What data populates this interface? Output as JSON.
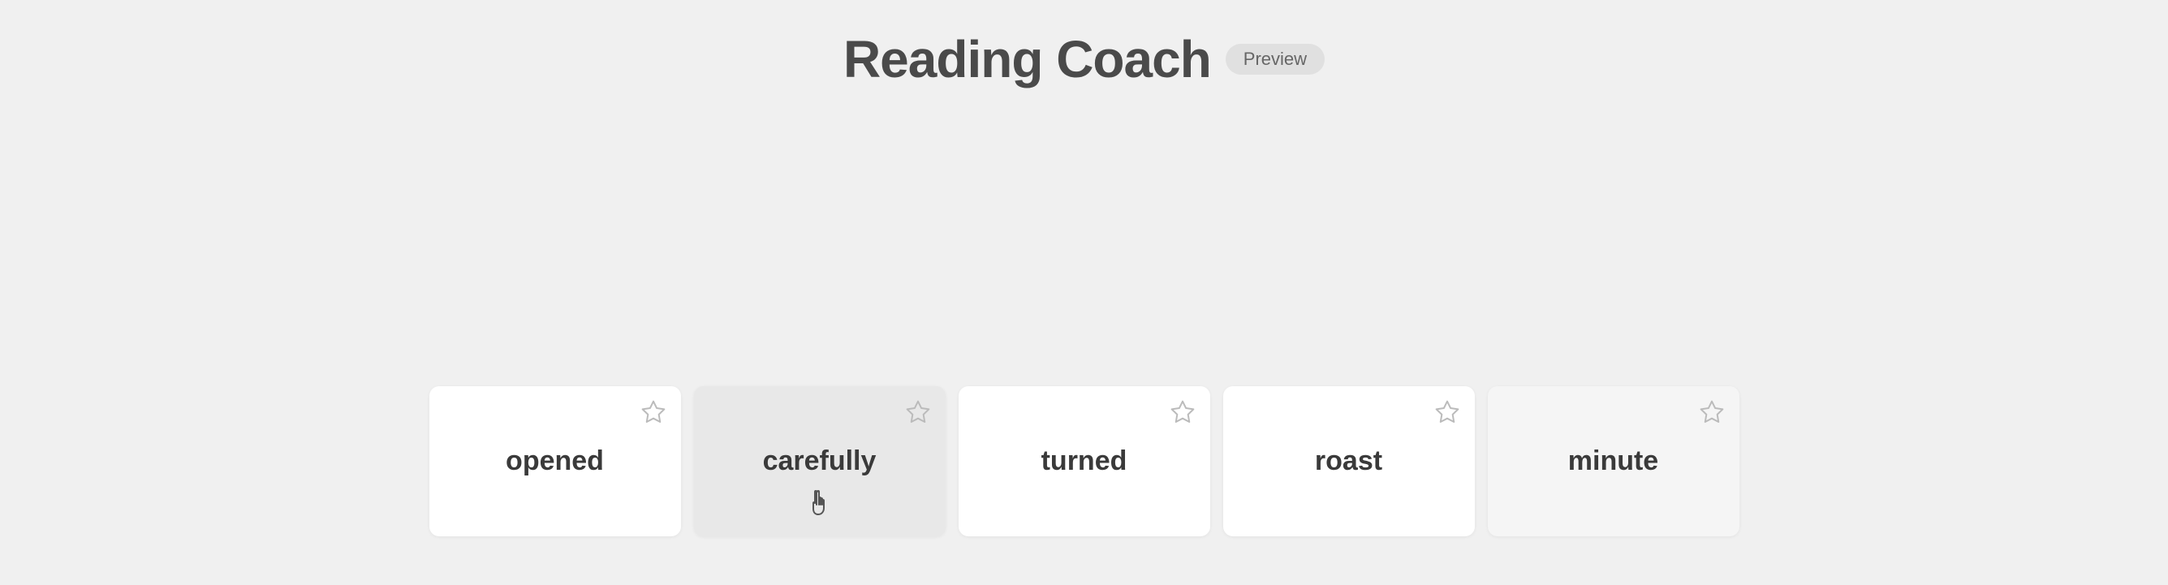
{
  "header": {
    "title": "Reading Coach",
    "preview_badge": "Preview"
  },
  "cards": [
    {
      "id": "opened",
      "label": "opened",
      "active": false
    },
    {
      "id": "carefully",
      "label": "carefully",
      "active": true
    },
    {
      "id": "turned",
      "label": "turned",
      "active": false
    },
    {
      "id": "roast",
      "label": "roast",
      "active": false
    },
    {
      "id": "minute",
      "label": "minute",
      "active": false
    }
  ],
  "icons": {
    "star": "☆"
  }
}
